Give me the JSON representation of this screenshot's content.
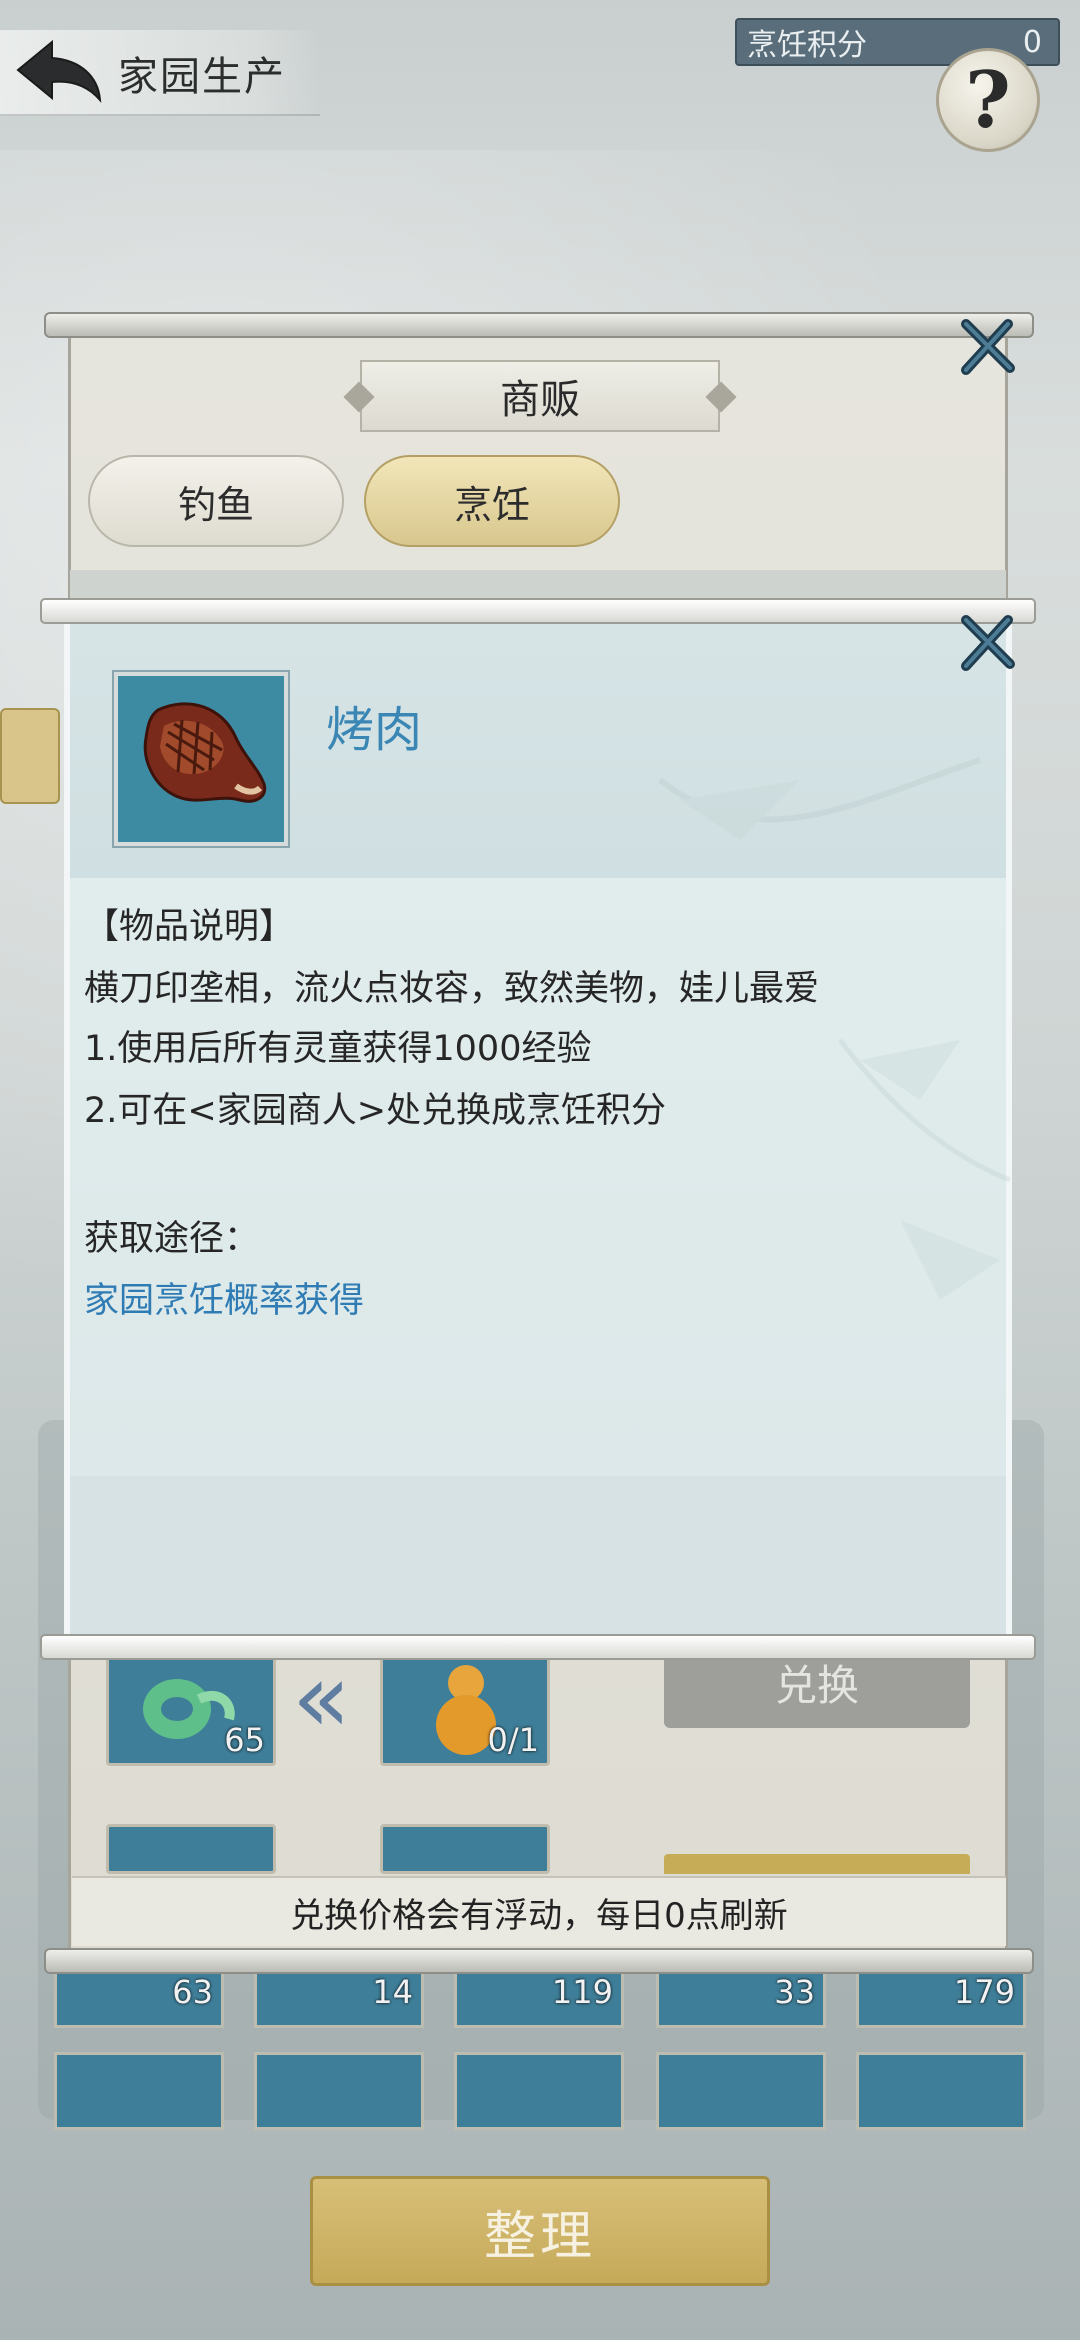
{
  "header": {
    "title": "家园生产",
    "score_label": "烹饪积分",
    "score_value": "0",
    "help_label": "?"
  },
  "shop": {
    "title": "商贩",
    "tabs": [
      {
        "label": "钓鱼",
        "selected": false
      },
      {
        "label": "烹饪",
        "selected": true
      }
    ],
    "exchange_row": {
      "cost_count": "65",
      "reward_count": "0/1",
      "exchange_label": "兑换"
    },
    "footer_note": "兑换价格会有浮动，每日0点刷新"
  },
  "inventory": {
    "counts": [
      "63",
      "14",
      "119",
      "33",
      "179"
    ],
    "arrange_label": "整理"
  },
  "item_detail": {
    "name": "烤肉",
    "section_title": "【物品说明】",
    "lines": [
      "横刀印垄相，流火点妆容，致然美物，娃儿最爱",
      "1.使用后所有灵童获得1000经验",
      "2.可在<家园商人>处兑换成烹饪积分"
    ],
    "source_title": "获取途径：",
    "source_link": "家园烹饪概率获得"
  },
  "colors": {
    "accent_blue": "#3a86b4",
    "item_slot": "#3f7e98",
    "gold": "#c6aa5a"
  }
}
